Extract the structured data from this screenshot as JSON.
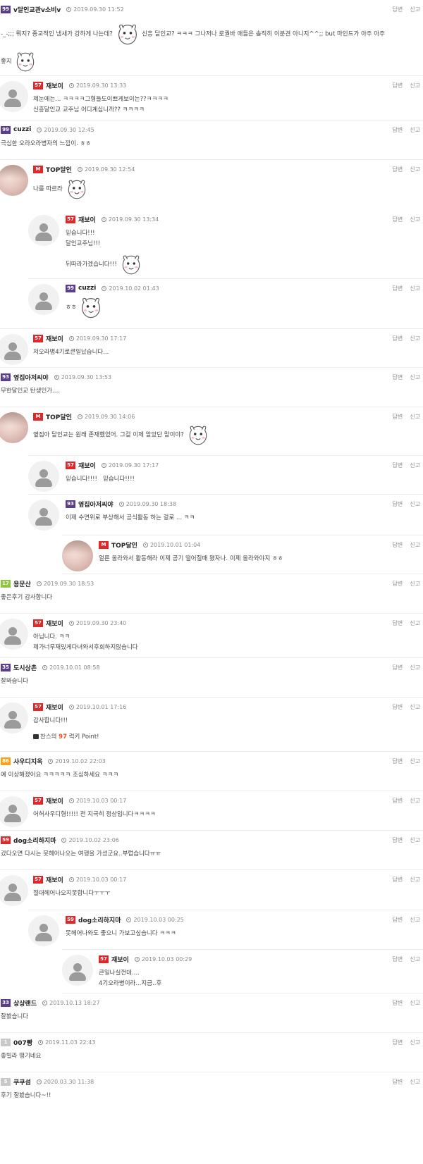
{
  "labels": {
    "reply": "답변",
    "report": "신고"
  },
  "colors": {
    "lv_purple": "#5b3d8f",
    "lv_red": "#e0282a",
    "lv_green": "#8dc63f",
    "lv_orange": "#f7a21b",
    "lv_gray": "#c8c8c8"
  },
  "comments": [
    {
      "level": "99",
      "nick": "v달인교관v소비v",
      "date": "2019.09.30 11:52",
      "text1": "-_-;;; 뭐지? 종교적인 냄새가 강하게 나는데?",
      "text2": "신흥 달인교? ㅋㅋㅋ 그나저나 로퀄바 애들은 솔직히 이분견 아니지^^;; but 마인드가 아주 아주",
      "text3": "좋지"
    },
    {
      "level": "57",
      "nick": "재보이",
      "date": "2019.09.30 13:33",
      "text1": "제눈에는... ㅋㅋㅋㅋ그형들도이쁘게보이는??ㅋㅋㅋㅋ",
      "text2": "신흥달인교 교주님 어디계십니까?? ㅋㅋㅋㅋ"
    },
    {
      "level": "99",
      "nick": "cuzzi",
      "date": "2019.09.30 12:45",
      "text1": "극심한 오라오라병자의 느낌이. ㅎㅎ"
    },
    {
      "level": "M",
      "nick": "TOP달인",
      "date": "2019.09.30 12:54",
      "text1": "나를 따르라"
    },
    {
      "level": "57",
      "nick": "재보이",
      "date": "2019.09.30 13:34",
      "text1": "믿습니다!!!",
      "text2": "달인교주님!!!",
      "text3": "뒤따라가겠습니다!!!"
    },
    {
      "level": "99",
      "nick": "cuzzi",
      "date": "2019.10.02 01:43",
      "text1": "ㅎㅎ"
    },
    {
      "level": "57",
      "nick": "재보이",
      "date": "2019.09.30 17:17",
      "text1": "저오라병4기로큰일났습니다..."
    },
    {
      "level": "93",
      "nick": "옆집아저씨야",
      "date": "2019.09.30 13:53",
      "text1": "무한달인교 탄생인가...."
    },
    {
      "level": "M",
      "nick": "TOP달인",
      "date": "2019.09.30 14:06",
      "text1": "옆집아 달인교는 원래 존재했었어. 그걸 이제 알았단 말이야?"
    },
    {
      "level": "57",
      "nick": "재보이",
      "date": "2019.09.30 17:17",
      "text1": "믿습니다!!!!   믿습니다!!!!"
    },
    {
      "level": "93",
      "nick": "옆집아저씨야",
      "date": "2019.09.30 18:38",
      "text1": "이제 수면위로 부상해서 공식활동 하는 걸로 ... ㅋㅋ"
    },
    {
      "level": "M",
      "nick": "TOP달인",
      "date": "2019.10.01 01:04",
      "text1": "얼른 올라와서 활동해라 이제 공기 떨어질때 됐자나. 이제 올라와야지 ㅎㅎ"
    },
    {
      "level": "17",
      "nick": "용문산",
      "date": "2019.09.30 18:53",
      "text1": "좋은후기 감사합니다"
    },
    {
      "level": "57",
      "nick": "재보이",
      "date": "2019.09.30 23:40",
      "text1": "아닙니다. ㅋㅋ",
      "text2": "제가너무재밌게다녀와서후회하지않습니다"
    },
    {
      "level": "35",
      "nick": "도시상촌",
      "date": "2019.10.01 08:58",
      "text1": "잘봐습니다"
    },
    {
      "level": "57",
      "nick": "재보이",
      "date": "2019.10.01 17:16",
      "text1": "감사합니다!!!",
      "point_pre": "찬스의",
      "point_num": "97",
      "point_post": "럭키 Point!"
    },
    {
      "level": "86",
      "nick": "사우디지옥",
      "date": "2019.10.02 22:03",
      "text1": "예 이상해졌어요 ㅋㅋㅋㅋㅋ 조심하세요 ㅋㅋㅋ"
    },
    {
      "level": "57",
      "nick": "재보이",
      "date": "2019.10.03 00:17",
      "text1": "어허사우디형!!!!! 전 지극히 정상입니다ㅋㅋㅋㅋ"
    },
    {
      "level": "59",
      "nick": "dog소리하지마",
      "date": "2019.10.02 23:06",
      "text1": "갔다오면 다시는 못헤어나오는 여행을 가셨군요..부럽습니다ㅠㅠ"
    },
    {
      "level": "57",
      "nick": "재보이",
      "date": "2019.10.03 00:17",
      "text1": "절대헤어나오지못합니다ㅜㅜㅜ"
    },
    {
      "level": "59",
      "nick": "dog소리하지마",
      "date": "2019.10.03 00:25",
      "text1": "못헤어나와도 좋으니 가보고싶습니다 ㅋㅋㅋ"
    },
    {
      "level": "57",
      "nick": "재보이",
      "date": "2019.10.03 00:29",
      "text1": "큰일나실껀데....",
      "text2": "4기오라병이라...지금..후"
    },
    {
      "level": "33",
      "nick": "상상랜드",
      "date": "2019.10.13 18:27",
      "text1": "잘봤습니다"
    },
    {
      "level": "1",
      "nick": "007빵",
      "date": "2019.11.03 22:43",
      "text1": "좋빌라 땡기네요"
    },
    {
      "level": "5",
      "nick": "쿠쿠섬",
      "date": "2020.03.30 11:38",
      "text1": "후기 잘봤습니다~!!"
    }
  ]
}
